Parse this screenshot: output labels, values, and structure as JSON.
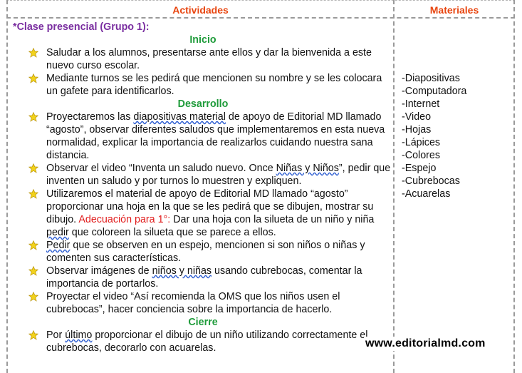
{
  "header": {
    "activities": "Actividades",
    "materials": "Materiales"
  },
  "group_title": "*Clase presencial (Grupo 1):",
  "sections": {
    "inicio": "Inicio",
    "desarrollo": "Desarrollo",
    "cierre": "Cierre"
  },
  "inicio_items": [
    "Saludar a los alumnos, presentarse ante ellos y dar la bienvenida a este nuevo curso escolar.",
    "Mediante turnos se les pedirá que mencionen su nombre y se les colocara un gafete para identificarlos."
  ],
  "desarrollo_items": {
    "item1_a": "Proyectaremos las ",
    "item1_b": "diapositivas material",
    "item1_c": " de apoyo de Editorial MD llamado “agosto”, observar diferentes saludos que implementaremos en esta nueva normalidad, explicar la importancia de realizarlos cuidando nuestra sana distancia.",
    "item2_a": "Observar el video “Inventa un saludo nuevo. Once ",
    "item2_b": "Niñas y Niños",
    "item2_c": "”, pedir que inventen un saludo y por turnos lo muestren y expliquen.",
    "item3_a": "Utilizaremos el material de apoyo de Editorial MD llamado “agosto” proporcionar una hoja en la que se les pedirá que se dibujen, mostrar su dibujo. ",
    "item3_adapt": "Adecuación para 1°:",
    "item3_b": " Dar una hoja con la silueta de un niño y niña ",
    "item3_c": "pedir",
    "item3_d": " que coloreen la silueta que se parece a ellos.",
    "item4_a": "Pedir",
    "item4_b": " que se observen en un espejo, mencionen si son niños o niñas y comenten sus características.",
    "item5_a": "Observar imágenes de ",
    "item5_b": "niños y niñas",
    "item5_c": " usando cubrebocas, comentar la importancia de portarlos.",
    "item6": "Proyectar el video “Así recomienda la OMS que los niños usen el cubrebocas”, hacer conciencia sobre la importancia de hacerlo."
  },
  "cierre_items": {
    "item1_a": "Por ",
    "item1_b": "último",
    "item1_c": " proporcionar el dibujo de un niño utilizando correctamente el cubrebocas, decorarlo con acuarelas."
  },
  "materials": [
    "-Diapositivas",
    "-Computadora",
    "-Internet",
    "-Video",
    "-Hojas",
    "-Lápices",
    "-Colores",
    "-Espejo",
    "-Cubrebocas",
    "-Acuarelas"
  ],
  "watermark": "www.editorialmd.com",
  "colors": {
    "header": "#e8450f",
    "group_title": "#7a2ea0",
    "section": "#1e9b3a",
    "adaptation": "#e11c1c",
    "bullet_star": "#f2d21b"
  }
}
